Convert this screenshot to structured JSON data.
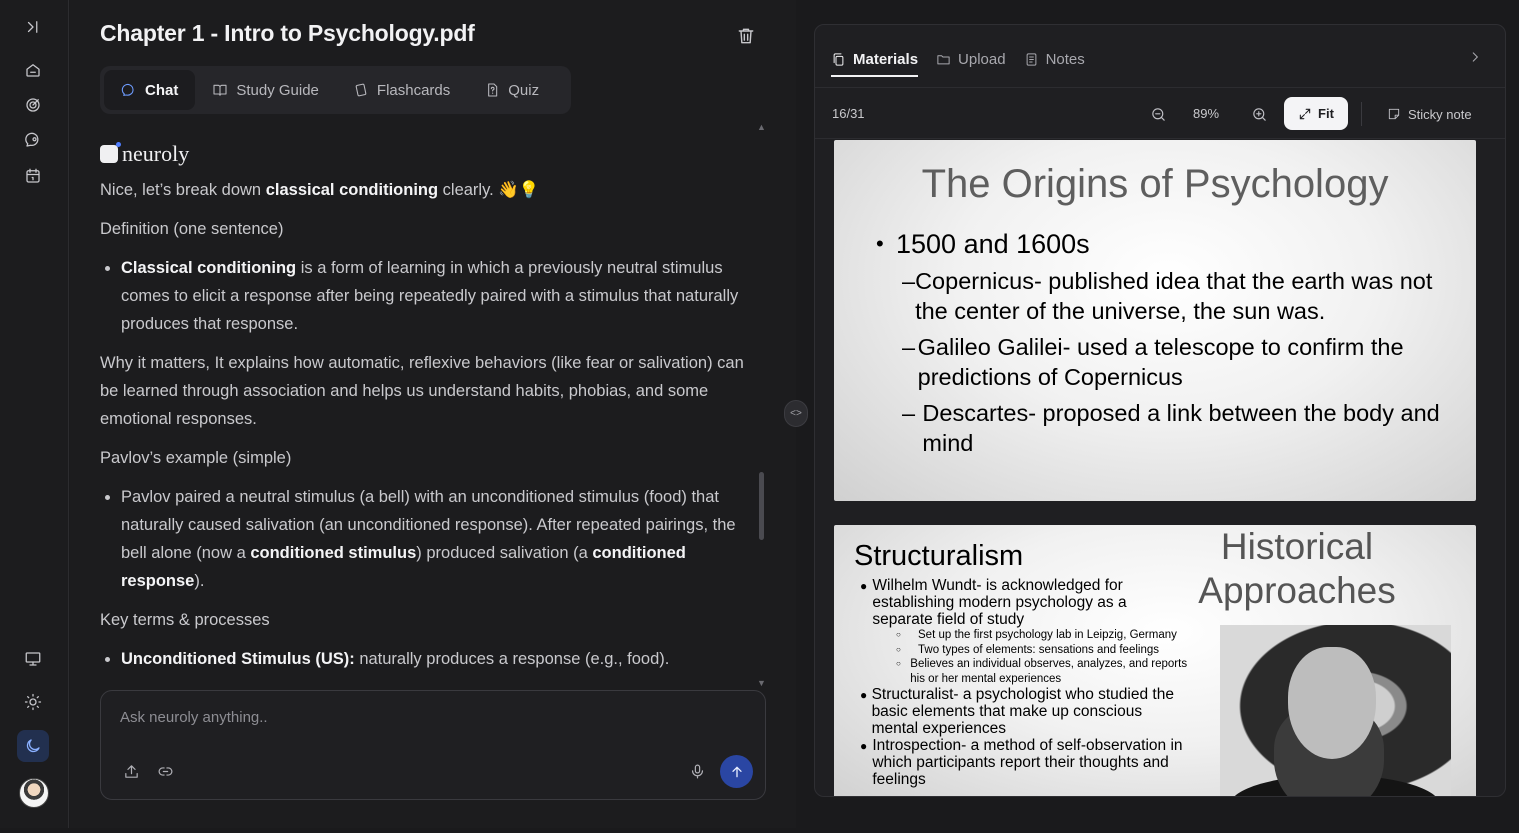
{
  "chat": {
    "title": "Chapter 1 - Intro to Psychology.pdf",
    "tabs": [
      {
        "label": "Chat",
        "icon": "chat-icon",
        "active": true
      },
      {
        "label": "Study Guide",
        "icon": "book-icon",
        "active": false
      },
      {
        "label": "Flashcards",
        "icon": "cards-icon",
        "active": false
      },
      {
        "label": "Quiz",
        "icon": "quiz-icon",
        "active": false
      }
    ],
    "brand": "neuroly",
    "message": {
      "intro_a": "Nice, let’s break down ",
      "intro_b": "classical conditioning",
      "intro_c": " clearly.",
      "intro_emoji": "👋💡",
      "def_heading": "Definition (one sentence)",
      "def_bold": "Classical conditioning",
      "def_text": " is a form of learning in which a previously neutral stimulus comes to elicit a response after being repeatedly paired with a stimulus that naturally produces that response.",
      "why": "Why it matters, It explains how automatic, reflexive behaviors (like fear or salivation) can be learned through association and helps us understand habits, phobias, and some emotional responses.",
      "pavlov_heading": "Pavlov’s example (simple)",
      "pavlov_a": "Pavlov paired a neutral stimulus (a bell) with an unconditioned stimulus (food) that naturally caused salivation (an unconditioned response). After repeated pairings, the bell alone (now a ",
      "pavlov_b": "conditioned stimulus",
      "pavlov_c": ") produced salivation (a ",
      "pavlov_d": "conditioned response",
      "pavlov_e": ").",
      "key_heading": "Key terms & processes",
      "us_bold": "Unconditioned Stimulus (US):",
      "us_text": " naturally produces a response (e.g., food)."
    },
    "composer": {
      "placeholder": "Ask neuroly anything.."
    }
  },
  "materials": {
    "tabs": [
      {
        "label": "Materials",
        "active": true
      },
      {
        "label": "Upload",
        "active": false
      },
      {
        "label": "Notes",
        "active": false
      }
    ],
    "page": "16/31",
    "zoom": "89%",
    "fit_label": "Fit",
    "sticky_label": "Sticky note",
    "slide1": {
      "title": "The Origins of Psychology",
      "bullet": "1500 and 1600s",
      "subs": [
        "Copernicus- published idea that the earth was not the center of the universe, the sun was.",
        "Galileo Galilei- used a telescope to confirm the predictions of Copernicus",
        "Descartes- proposed a link between the body and mind"
      ]
    },
    "slide2": {
      "title": "Structuralism",
      "side_title": "Historical Approaches",
      "b1": "Wilhelm Wundt- is acknowledged for establishing modern psychology as a separate field of study",
      "b1_subs": [
        "Set up the first psychology lab in Leipzig, Germany",
        "Two types of elements: sensations and feelings",
        "Believes an individual observes, analyzes, and reports his or her mental experiences"
      ],
      "b2": "Structuralist- a psychologist who studied the basic elements that make up conscious mental experiences",
      "b3": "Introspection- a method of self-observation in which participants report their thoughts and feelings"
    }
  }
}
